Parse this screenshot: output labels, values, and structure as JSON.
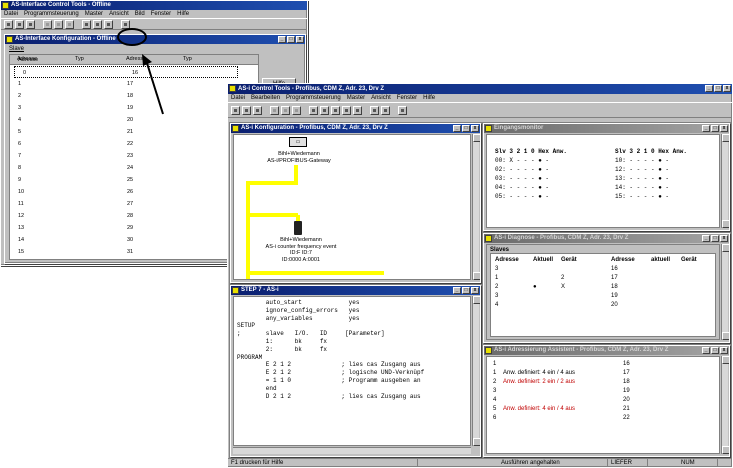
{
  "app1": {
    "title": "AS-Interface Control Tools - Offline",
    "menu": [
      "Datei",
      "Programmsteuerung",
      "Master",
      "Ansicht",
      "Bild",
      "Fenster",
      "Hilfe"
    ],
    "child_title": "AS-Interface Konfiguration - Offline",
    "tab_label": "Slave",
    "col_headers": [
      "Adresse",
      "Typ",
      "Adresse",
      "Typ"
    ],
    "hilfe_button": "Hilfe",
    "left_addresses": [
      "0",
      "1",
      "2",
      "3",
      "4",
      "5",
      "6",
      "7",
      "8",
      "9",
      "10",
      "11",
      "12",
      "13",
      "14",
      "15"
    ],
    "right_addresses": [
      "16",
      "17",
      "18",
      "19",
      "20",
      "21",
      "22",
      "23",
      "24",
      "25",
      "26",
      "27",
      "28",
      "29",
      "30",
      "31"
    ]
  },
  "app2": {
    "title": "AS-i Control Tools - Profibus, CDM Z, Adr. 23, Drv Z",
    "menu": [
      "Datei",
      "Bearbeiten",
      "Programmsteuerung",
      "Master",
      "Ansicht",
      "Fenster",
      "Hilfe"
    ],
    "status": [
      "F1 drucken für Hilfe",
      "Ausführen angehalten",
      "LIEFER",
      "NUM"
    ]
  },
  "config": {
    "title": "AS-i Konfiguration - Profibus, CDM Z, Adr. 23, Drv Z",
    "gateway_lines": [
      "Bihl+Wiedemann",
      "AS-i/PROFIBUS-Gateway"
    ],
    "slave_lines": [
      "Bihl+Wiedemann",
      "AS-i counter frequency event",
      "ID:F ID:7",
      "ID:0000 A:0001"
    ],
    "gateway_icon": "master-module-icon",
    "slave_icon": "slave-module-icon"
  },
  "eingang": {
    "title": "Eingangsmonitor",
    "header_left": "Slv 3 2 1 0 Hex Anw.",
    "header_right": "Slv 3 2 1 0 Hex Anw.",
    "rows": [
      {
        "l": "00: X - - - ●  -",
        "r": "10: - - - - ●  -"
      },
      {
        "l": "02: - - - - ●  -",
        "r": "12: - - - - ●  -"
      },
      {
        "l": "03: - - - - ●  -",
        "r": "13: - - - - ●  -"
      },
      {
        "l": "04: - - - - ●  -",
        "r": "14: - - - - ●  -"
      },
      {
        "l": "05: - - - - ●  -",
        "r": "15: - - - - ●  -"
      }
    ]
  },
  "diagnose": {
    "title": "AS-i Diagnose - Profibus, CDM Z, Adr. 23, Drv Z",
    "group": "Slaves",
    "headers": [
      "Adresse",
      "Aktuell",
      "Gerät",
      "Adresse",
      "aktuell",
      "Gerät"
    ],
    "rows": [
      {
        "a": "3",
        "b": "",
        "c": "",
        "d": "16"
      },
      {
        "a": "1",
        "b": "",
        "c": "2",
        "d": "17"
      },
      {
        "a": "2",
        "b": "●",
        "c": "X",
        "d": "18"
      },
      {
        "a": "3",
        "b": "",
        "c": "",
        "d": "19"
      },
      {
        "a": "4",
        "b": "",
        "c": "",
        "d": "20"
      }
    ]
  },
  "adressierung": {
    "title": "AS-i Adressierung Assistent - Profibus, CDM Z, Adr. 23, Drv Z",
    "rows": [
      {
        "n": "1",
        "t": "",
        "r": "16"
      },
      {
        "n": "1",
        "t": "Anw. definiert: 4 ein / 4 aus",
        "r": "17"
      },
      {
        "n": "2",
        "t": "Anw. definiert: 2 ein / 2 aus",
        "r": "18"
      },
      {
        "n": "3",
        "t": "",
        "r": "19"
      },
      {
        "n": "4",
        "t": "",
        "r": "20"
      },
      {
        "n": "5",
        "t": "Anw. definiert: 4 ein / 4 aus",
        "r": "21"
      },
      {
        "n": "6",
        "t": "",
        "r": "22"
      }
    ]
  },
  "editor": {
    "title": "STEP 7 - AS-i",
    "lines": [
      "        auto_start             yes",
      "        ignore_config_errors   yes",
      "        any_variables          yes",
      "SETUP",
      ";       slave   I/O.   ID     [Parameter]",
      "        1:      bk     fx",
      "        2:      bk     fx",
      "",
      "PROGRAM",
      "        E 2 1 2              ; lies cas Zusgang aus",
      "        E 2 1 2              ; logische UND-Verknüpf",
      "        = 1 1 0              ; Programm ausgeben an",
      "        end",
      "",
      "        D 2 1 2              ; lies cas Zusgang aus"
    ]
  },
  "colors": {
    "title_active": "#0a1e6e",
    "wire": "#ffff00",
    "red_mark": "#c00000"
  }
}
